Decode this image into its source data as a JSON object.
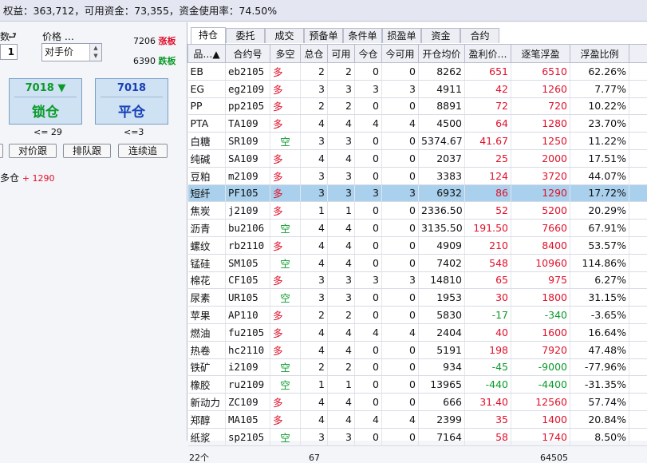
{
  "topbar": {
    "text": "权益：363,712，可用资金：73,355，资金使用率：74.50%"
  },
  "order_panel": {
    "qty_label": "数",
    "qty_icon": "⮐",
    "qty_value": "1",
    "price_label": "价格 …",
    "price_value": "对手价",
    "limit_up_price": "7206",
    "limit_up_label": "涨板",
    "limit_down_price": "6390",
    "limit_down_label": "跌板",
    "lock": {
      "price": "7018",
      "arrow": "▼",
      "label": "锁仓",
      "cond": "<= 29"
    },
    "close": {
      "price": "7018",
      "label": "平仓",
      "cond": "<=3"
    },
    "buttons": {
      "b0": "",
      "b1": "对价跟",
      "b2": "排队跟",
      "b3": "连续追"
    },
    "pos_summary": {
      "label": "多仓",
      "value": "+ 1290"
    }
  },
  "tabs": [
    "持仓",
    "委托",
    "成交",
    "预备单",
    "条件单",
    "损盈单",
    "资金",
    "合约"
  ],
  "columns": [
    "品…▲",
    "合约号",
    "多空",
    "总仓",
    "可用",
    "今仓",
    "今可用",
    "开仓均价",
    "盈利价…",
    "逐笔浮盈",
    "浮盈比例"
  ],
  "rows": [
    [
      "EB",
      "eb2105",
      "多",
      "2",
      "2",
      "0",
      "0",
      "8262",
      "651",
      "6510",
      "62.26%"
    ],
    [
      "EG",
      "eg2109",
      "多",
      "3",
      "3",
      "3",
      "3",
      "4911",
      "42",
      "1260",
      "7.77%"
    ],
    [
      "PP",
      "pp2105",
      "多",
      "2",
      "2",
      "0",
      "0",
      "8891",
      "72",
      "720",
      "10.22%"
    ],
    [
      "PTA",
      "TA109",
      "多",
      "4",
      "4",
      "4",
      "4",
      "4500",
      "64",
      "1280",
      "23.70%"
    ],
    [
      "白糖",
      "SR109",
      "空",
      "3",
      "3",
      "0",
      "0",
      "5374.67",
      "41.67",
      "1250",
      "11.22%"
    ],
    [
      "纯碱",
      "SA109",
      "多",
      "4",
      "4",
      "0",
      "0",
      "2037",
      "25",
      "2000",
      "17.51%"
    ],
    [
      "豆粕",
      "m2109",
      "多",
      "3",
      "3",
      "0",
      "0",
      "3383",
      "124",
      "3720",
      "44.07%"
    ],
    [
      "短纤",
      "PF105",
      "多",
      "3",
      "3",
      "3",
      "3",
      "6932",
      "86",
      "1290",
      "17.72%"
    ],
    [
      "焦炭",
      "j2109",
      "多",
      "1",
      "1",
      "0",
      "0",
      "2336.50",
      "52",
      "5200",
      "20.29%"
    ],
    [
      "沥青",
      "bu2106",
      "空",
      "4",
      "4",
      "0",
      "0",
      "3135.50",
      "191.50",
      "7660",
      "67.91%"
    ],
    [
      "螺纹",
      "rb2110",
      "多",
      "4",
      "4",
      "0",
      "0",
      "4909",
      "210",
      "8400",
      "53.57%"
    ],
    [
      "锰硅",
      "SM105",
      "空",
      "4",
      "4",
      "0",
      "0",
      "7402",
      "548",
      "10960",
      "114.86%"
    ],
    [
      "棉花",
      "CF105",
      "多",
      "3",
      "3",
      "3",
      "3",
      "14810",
      "65",
      "975",
      "6.27%"
    ],
    [
      "尿素",
      "UR105",
      "空",
      "3",
      "3",
      "0",
      "0",
      "1953",
      "30",
      "1800",
      "31.15%"
    ],
    [
      "苹果",
      "AP110",
      "多",
      "2",
      "2",
      "0",
      "0",
      "5830",
      "-17",
      "-340",
      "-3.65%"
    ],
    [
      "燃油",
      "fu2105",
      "多",
      "4",
      "4",
      "4",
      "4",
      "2404",
      "40",
      "1600",
      "16.64%"
    ],
    [
      "热卷",
      "hc2110",
      "多",
      "4",
      "4",
      "0",
      "0",
      "5191",
      "198",
      "7920",
      "47.48%"
    ],
    [
      "铁矿",
      "i2109",
      "空",
      "2",
      "2",
      "0",
      "0",
      "934",
      "-45",
      "-9000",
      "-77.96%"
    ],
    [
      "橡胶",
      "ru2109",
      "空",
      "1",
      "1",
      "0",
      "0",
      "13965",
      "-440",
      "-4400",
      "-31.35%"
    ],
    [
      "新动力",
      "ZC109",
      "多",
      "4",
      "4",
      "0",
      "0",
      "666",
      "31.40",
      "12560",
      "57.74%"
    ],
    [
      "郑醇",
      "MA105",
      "多",
      "4",
      "4",
      "4",
      "4",
      "2399",
      "35",
      "1400",
      "20.84%"
    ],
    [
      "纸浆",
      "sp2105",
      "空",
      "3",
      "3",
      "0",
      "0",
      "7164",
      "58",
      "1740",
      "8.50%"
    ]
  ],
  "selected_row": 7,
  "footer": {
    "count": "22个",
    "total": "67",
    "float_total": "64505"
  },
  "colors": {
    "long": "#e0102a",
    "short": "#0a9a2a",
    "selected": "#a9d0ec"
  }
}
